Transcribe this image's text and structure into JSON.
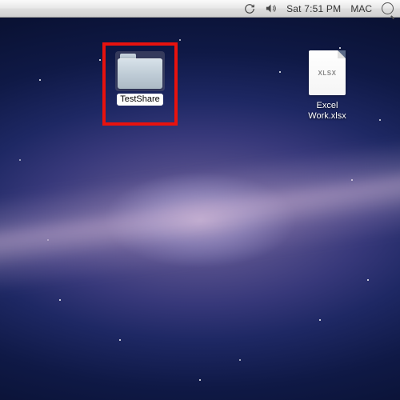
{
  "menubar": {
    "clock": "Sat 7:51 PM",
    "user": "MAC"
  },
  "desktop_items": {
    "folder": {
      "label": "TestShare",
      "selected": true
    },
    "file": {
      "label": "Excel Work.xlsx",
      "type_badge": "XLSX"
    }
  },
  "highlight": {
    "target": "folder",
    "color": "#e8120e"
  }
}
